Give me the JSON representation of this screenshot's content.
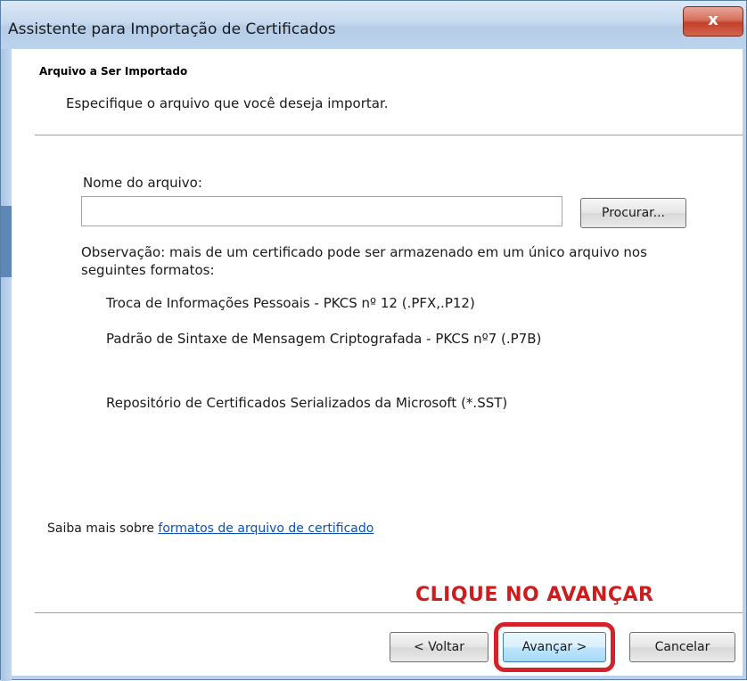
{
  "window": {
    "title": "Assistente para Importação de Certificados",
    "close_label": "x"
  },
  "header": {
    "title": "Arquivo a Ser Importado",
    "subtitle": "Especifique o arquivo que você deseja importar."
  },
  "file": {
    "label": "Nome do arquivo:",
    "value": "",
    "placeholder": "",
    "browse_label": "Procurar..."
  },
  "note": {
    "text": "Observação: mais de um certificado pode ser armazenado em um único arquivo nos seguintes formatos:",
    "formats": [
      "Troca de Informações Pessoais - PKCS nº 12 (.PFX,.P12)",
      "Padrão de Sintaxe de Mensagem Criptografada - PKCS nº7 (.P7B)",
      "Repositório de Certificados Serializados da Microsoft (*.SST)"
    ]
  },
  "learn_more": {
    "prefix": "Saiba mais sobre ",
    "link": "formatos de arquivo de certificado"
  },
  "annotation": {
    "text": "CLIQUE NO AVANÇAR",
    "color": "#cc1c1c"
  },
  "buttons": {
    "back": "< Voltar",
    "next": "Avançar >",
    "cancel": "Cancelar"
  },
  "colors": {
    "highlight": "#d4222a",
    "link": "#0a52b6",
    "titlebar": "#c6d9ee"
  }
}
